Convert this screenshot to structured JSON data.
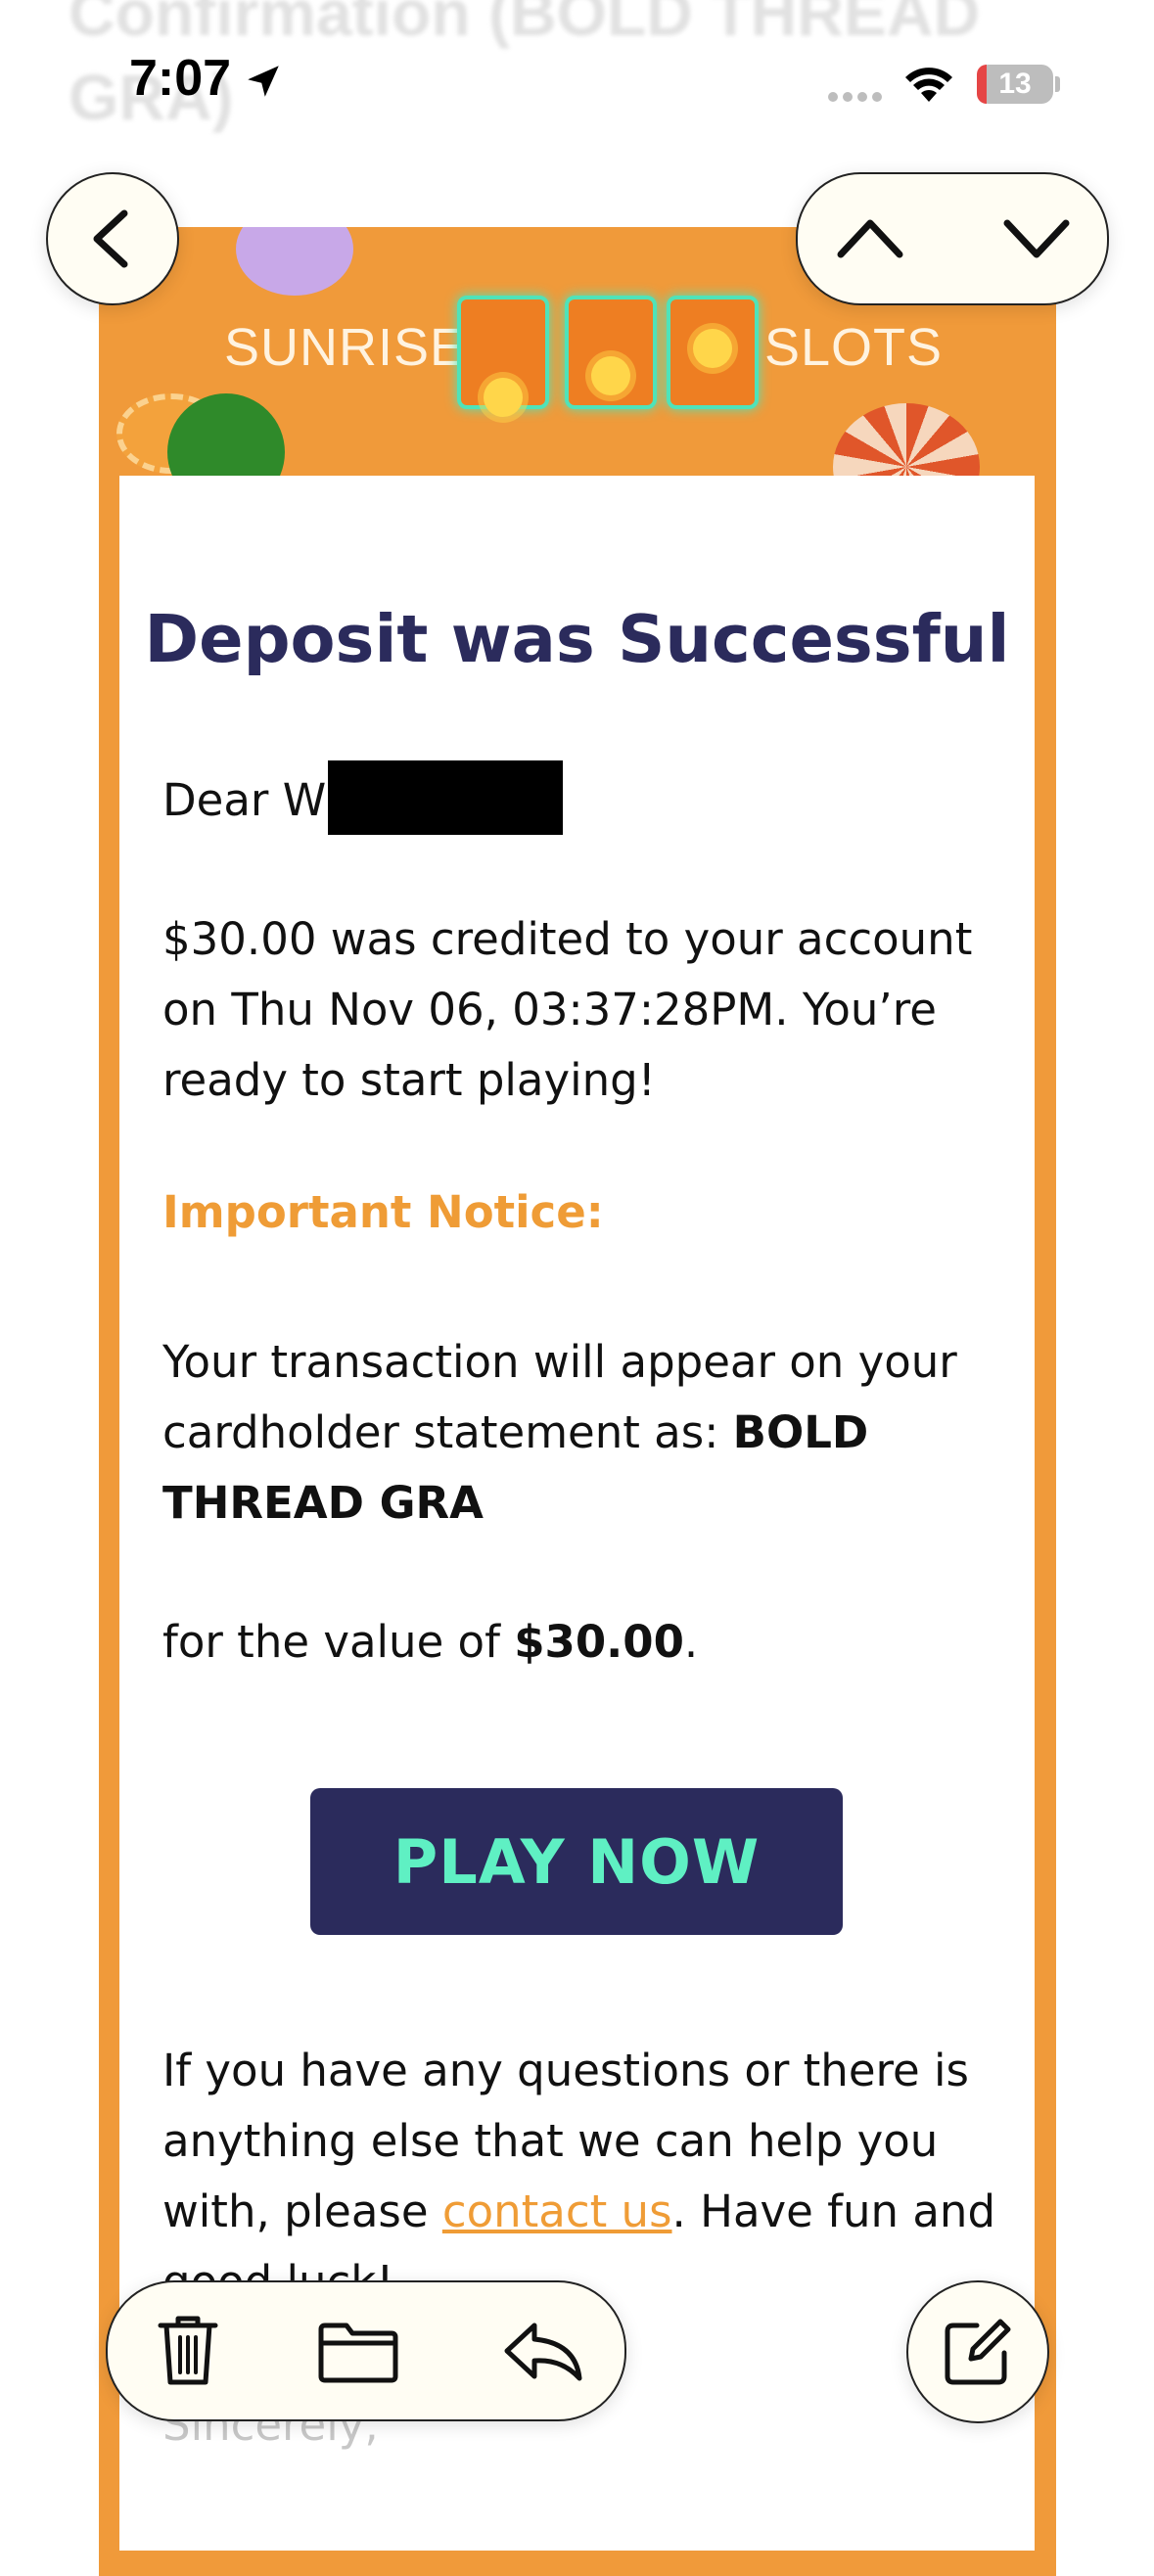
{
  "header": {
    "ghost_title": "Confirmation (BOLD THREAD GRA)"
  },
  "status_bar": {
    "time": "7:07",
    "battery": "13",
    "battery_level_percent": 13
  },
  "banner": {
    "logo_left": "SUNRISE",
    "logo_right": "SLOTS"
  },
  "email": {
    "headline": "Deposit was Successful",
    "greeting": "Dear W",
    "credit_message": "$30.00 was credited to your account on Thu Nov 06, 03:37:28PM. You’re ready to start playing!",
    "notice_label": "Important Notice:",
    "statement_prefix": "Your transaction will appear on your cardholder statement as: ",
    "statement_name": "BOLD THREAD GRA",
    "value_prefix": "for the value of ",
    "value_amount": "$30.00",
    "value_suffix": ".",
    "play_button": "PLAY NOW",
    "help_prefix": "If you have any questions or there is anything else that we can help you with, please ",
    "help_link": "contact us",
    "help_suffix": ". Have fun and good luck!",
    "signoff": "Sincerely,"
  },
  "toolbar": {
    "icons": [
      "trash-icon",
      "folder-icon",
      "reply-icon",
      "compose-icon"
    ]
  },
  "nav": {
    "icons": [
      "back-chevron-icon",
      "chevron-up-icon",
      "chevron-down-icon"
    ]
  },
  "colors": {
    "brand_orange": "#f09a3a",
    "headline_navy": "#2b2b5c",
    "button_text": "#5ff0c3",
    "notice_orange": "#ef9c36"
  }
}
